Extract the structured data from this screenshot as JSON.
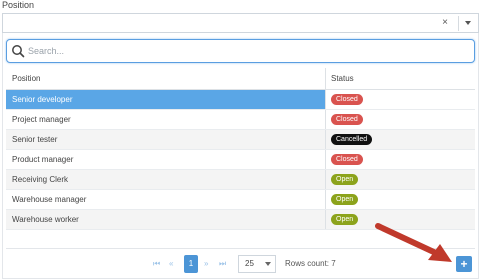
{
  "field": {
    "label": "Position",
    "clear_glyph": "×"
  },
  "search": {
    "placeholder": "Search...",
    "value": ""
  },
  "table": {
    "columns": [
      "Position",
      "Status"
    ],
    "rows": [
      {
        "position": "Senior developer",
        "status": "Closed",
        "selected": true
      },
      {
        "position": "Project manager",
        "status": "Closed"
      },
      {
        "position": "Senior tester",
        "status": "Cancelled"
      },
      {
        "position": "Product manager",
        "status": "Closed"
      },
      {
        "position": "Receiving Clerk",
        "status": "Open"
      },
      {
        "position": "Warehouse manager",
        "status": "Open"
      },
      {
        "position": "Warehouse worker",
        "status": "Open"
      }
    ]
  },
  "status_colors": {
    "Closed": "#d9534f",
    "Cancelled": "#111111",
    "Open": "#8ca31c"
  },
  "pager": {
    "first_glyph": "⏮",
    "prev_glyph": "«",
    "current_page": "1",
    "next_glyph": "»",
    "last_glyph": "⏭",
    "page_size": "25",
    "rows_count_text": "Rows count: 7"
  },
  "add_button": {
    "label": "+"
  },
  "colors": {
    "accent": "#4c95d6",
    "selected_row": "#5aa6e6",
    "pointer_arrow": "#c0392b"
  }
}
